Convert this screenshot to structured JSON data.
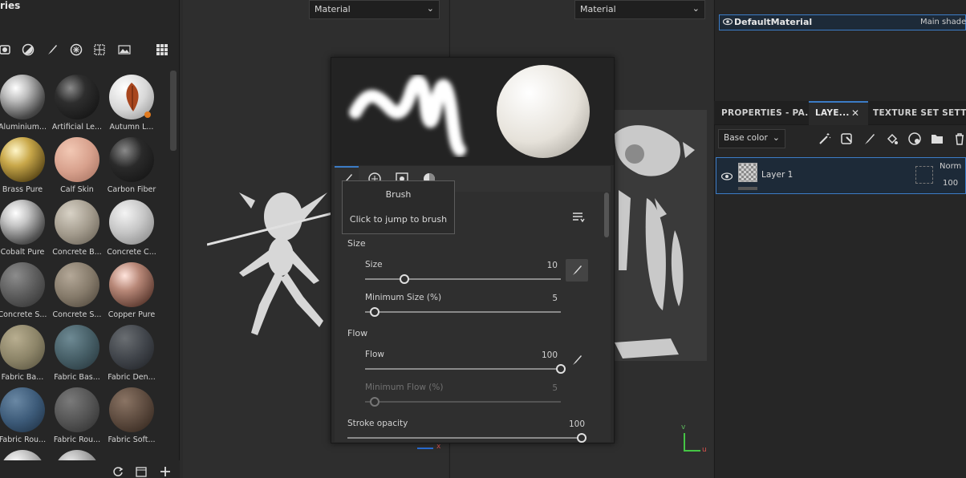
{
  "shelf": {
    "title": "ries",
    "materials": [
      {
        "label": "Aluminium...",
        "color": "radial-gradient(circle at 35% 30%, #ffffff 0%, #bdbdbd 30%, #4a4a4a 70%, #1a1a1a 100%)"
      },
      {
        "label": "Artificial Le...",
        "color": "radial-gradient(circle at 35% 30%, #8a8a8a 0%, #2e2e2e 35%, #0d0d0d 100%)"
      },
      {
        "label": "Autumn L...",
        "color": "radial-gradient(circle at 35% 30%, #ffffff 0%, #d8d8d8 50%, #8a8a8a 100%)"
      },
      {
        "label": "Brass Pure",
        "color": "radial-gradient(circle at 35% 30%, #fff6c8 0%, #c9a84a 35%, #5a4716 80%, #2b2208 100%)"
      },
      {
        "label": "Calf Skin",
        "color": "radial-gradient(circle at 35% 30%, #f2c8b4 0%, #d7a08c 50%, #9e6b5a 100%)"
      },
      {
        "label": "Carbon Fiber",
        "color": "radial-gradient(circle at 35% 30%, #8a8a8a 0%, #2a2a2a 40%, #0f0f0f 100%)"
      },
      {
        "label": "Cobalt Pure",
        "color": "radial-gradient(circle at 35% 30%, #ffffff 0%, #c4c4c4 30%, #555 70%, #1e1e1e 100%)"
      },
      {
        "label": "Concrete B...",
        "color": "radial-gradient(circle at 35% 30%, #d8d2c6 0%, #a29a8c 50%, #5e574c 100%)"
      },
      {
        "label": "Concrete C...",
        "color": "radial-gradient(circle at 35% 30%, #f4f4f4 0%, #c6c6c6 45%, #7c7c7c 100%)"
      },
      {
        "label": "Concrete S...",
        "color": "radial-gradient(circle at 35% 30%, #8c8c8c 0%, #5a5a5a 50%, #2c2c2c 100%)"
      },
      {
        "label": "Concrete S...",
        "color": "radial-gradient(circle at 35% 30%, #b4a898 0%, #857a6a 50%, #463e34 100%)"
      },
      {
        "label": "Copper Pure",
        "color": "radial-gradient(circle at 35% 30%, #ffe4dc 0%, #b88878 35%, #5c3a30 80%, #2a1814 100%)"
      },
      {
        "label": "Fabric Ba...",
        "color": "radial-gradient(circle at 35% 30%, #b8ae90 0%, #8c8468 50%, #4e4a38 100%)"
      },
      {
        "label": "Fabric Bas...",
        "color": "radial-gradient(circle at 35% 30%, #6e8a94 0%, #465e66 50%, #223036 100%)"
      },
      {
        "label": "Fabric Den...",
        "color": "radial-gradient(circle at 35% 30%, #6a6e72 0%, #40444a 50%, #1c1e22 100%)"
      },
      {
        "label": "Fabric Rou...",
        "color": "radial-gradient(circle at 35% 30%, #6a88a4 0%, #3c5a78 50%, #1a2a3c 100%)"
      },
      {
        "label": "Fabric Rou...",
        "color": "radial-gradient(circle at 35% 30%, #7a7a7a 0%, #545454 50%, #2a2a2a 100%)"
      },
      {
        "label": "Fabric Soft...",
        "color": "radial-gradient(circle at 35% 30%, #8a7464 0%, #5c4a3e 50%, #2c2018 100%)"
      }
    ]
  },
  "viewport3d": {
    "select_value": "Material",
    "axis_label": "x"
  },
  "viewport2d": {
    "select_value": "Material",
    "axis_v": "v",
    "axis_u": "u"
  },
  "texture_set_list": {
    "row_name": "DefaultMaterial",
    "row_shader": "Main shader"
  },
  "tabs": [
    "PROPERTIES - PA...",
    "LAYE...",
    "TEXTURE SET SETTIN"
  ],
  "layers": {
    "channel_select": "Base color",
    "layer_name": "Layer 1",
    "blend_mode": "Norm",
    "opacity": "100"
  },
  "popup": {
    "tooltip_title": "Brush",
    "tooltip_text": "Click to jump to brush",
    "section_size": "Size",
    "size_label": "Size",
    "size_value": "10",
    "size_fraction": 0.2,
    "min_size_label": "Minimum Size (%)",
    "min_size_value": "5",
    "min_size_fraction": 0.05,
    "section_flow": "Flow",
    "flow_label": "Flow",
    "flow_value": "100",
    "flow_fraction": 1.0,
    "min_flow_label": "Minimum Flow (%)",
    "min_flow_value": "5",
    "min_flow_fraction": 0.05,
    "stroke_opacity_label": "Stroke opacity",
    "stroke_opacity_value": "100",
    "stroke_opacity_fraction": 1.0
  },
  "colors": {
    "accent": "#3c7cc6",
    "selection": "#1d2a38",
    "orange_badge": "#e07a1f"
  }
}
